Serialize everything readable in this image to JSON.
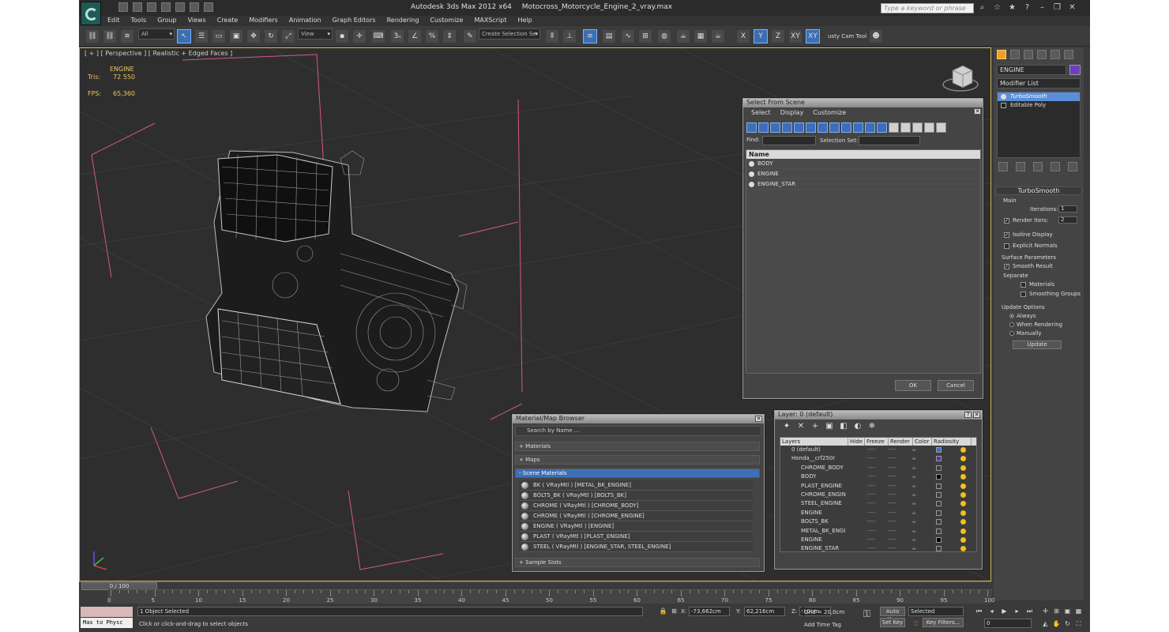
{
  "window": {
    "app_title": "Autodesk 3ds Max  2012 x64",
    "file_name": "Motocross_Motorcycle_Engine_2_vray.max",
    "search_placeholder": "Type a keyword or phrase"
  },
  "menu": [
    "Edit",
    "Tools",
    "Group",
    "Views",
    "Create",
    "Modifiers",
    "Animation",
    "Graph Editors",
    "Rendering",
    "Customize",
    "MAXScript",
    "Help"
  ],
  "toolbar": {
    "selection_filter": "All",
    "ref_coord": "View",
    "named_selection": "Create Selection Se",
    "axis_x": "X",
    "axis_y": "Y",
    "axis_z": "Z",
    "axis_xy": "XY",
    "axis_xy2": "XY",
    "custom_tool": "usty Cam Tool"
  },
  "viewport": {
    "label": "[ + ] [ Perspective ] [ Realistic + Edged Faces ]",
    "object_name": "ENGINE",
    "tris_label": "Tris:",
    "tris_value": "72 550",
    "fps_label": "FPS:",
    "fps_value": "65,360"
  },
  "command_panel": {
    "object_name": "ENGINE",
    "object_color": "#6a3fc0",
    "modifier_list": "Modifier List",
    "stack": [
      "TurboSmooth",
      "Editable Poly"
    ],
    "rollout_title": "TurboSmooth",
    "main_group": "Main",
    "iterations_label": "Iterations:",
    "iterations_value": "1",
    "render_iters_label": "Render Iters:",
    "render_iters_value": "2",
    "isoline_display": "Isoline Display",
    "explicit_normals": "Explicit Normals",
    "surface_params": "Surface Parameters",
    "smooth_result": "Smooth Result",
    "separate": "Separate",
    "materials": "Materials",
    "smoothing_groups": "Smoothing Groups",
    "update_options": "Update Options",
    "always": "Always",
    "when_rendering": "When Rendering",
    "manually": "Manually",
    "update_button": "Update"
  },
  "select_from_scene": {
    "title": "Select From Scene",
    "menu": [
      "Select",
      "Display",
      "Customize"
    ],
    "find_label": "Find:",
    "selection_set_label": "Selection Set:",
    "column_name": "Name",
    "rows": [
      "BODY",
      "ENGINE",
      "ENGINE_STAR"
    ],
    "ok": "OK",
    "cancel": "Cancel"
  },
  "material_browser": {
    "title": "Material/Map Browser",
    "search_placeholder": "Search by Name ...",
    "sections": [
      "+ Materials",
      "+ Maps",
      "- Scene Materials",
      "+ Sample Slots"
    ],
    "items": [
      "BK  ( VRayMtl )  [METAL_BK_ENGINE]",
      "BOLTS_BK  ( VRayMtl )  [BOLTS_BK]",
      "CHROME  ( VRayMtl )  [CHROME_BODY]",
      "CHROME  ( VRayMtl )  [CHROME_ENGINE]",
      "ENGINE  ( VRayMtl )  [ENGINE]",
      "PLAST  ( VRayMtl )  [PLAST_ENGINE]",
      "STEEL  ( VRayMtl )  [ENGINE_STAR, STEEL_ENGINE]"
    ]
  },
  "layer_manager": {
    "title": "Layer: 0 (default)",
    "columns": [
      "Layers",
      "Hide",
      "Freeze",
      "Render",
      "Color",
      "Radiosity"
    ],
    "rows": [
      {
        "name": "0 (default)",
        "indent": 0,
        "color": "#3a6fd0"
      },
      {
        "name": "Honda__crf250r",
        "indent": 0,
        "color": "#5a2fb0"
      },
      {
        "name": "CHROME_BODY",
        "indent": 2,
        "color": "#3c3c3c"
      },
      {
        "name": "BODY",
        "indent": 2,
        "color": "#000000"
      },
      {
        "name": "PLAST_ENGINE",
        "indent": 2,
        "color": "#3c3c3c"
      },
      {
        "name": "CHROME_ENGIN",
        "indent": 2,
        "color": "#3c3c3c"
      },
      {
        "name": "STEEL_ENGINE",
        "indent": 2,
        "color": "#3c3c3c"
      },
      {
        "name": "ENGINE",
        "indent": 2,
        "color": "#3c3c3c"
      },
      {
        "name": "BOLTS_BK",
        "indent": 2,
        "color": "#3c3c3c"
      },
      {
        "name": "METAL_BK_ENGI",
        "indent": 2,
        "color": "#3c3c3c"
      },
      {
        "name": "ENGINE",
        "indent": 2,
        "color": "#000000"
      },
      {
        "name": "ENGINE_STAR",
        "indent": 2,
        "color": "#3c3c3c"
      }
    ]
  },
  "timeline": {
    "frame_display": "0 / 100",
    "ticks": [
      "0",
      "5",
      "10",
      "15",
      "20",
      "25",
      "30",
      "35",
      "40",
      "45",
      "50",
      "55",
      "60",
      "65",
      "70",
      "75",
      "80",
      "85",
      "90",
      "95",
      "100"
    ]
  },
  "status": {
    "maxscript_text": "Max to Physc",
    "selection": "1 Object Selected",
    "prompt": "Click or click-and-drag to select objects",
    "x_label": "X:",
    "x_value": "-73,662cm",
    "y_label": "Y:",
    "y_value": "62,216cm",
    "z_label": "Z:",
    "z_value": "0,0cm",
    "grid": "Grid = 20,0cm",
    "add_time_tag": "Add Time Tag",
    "auto_key": "Auto Key",
    "set_key": "Set Key",
    "key_mode": "Selected",
    "key_filters": "Key Filters...",
    "current_frame": "0"
  }
}
